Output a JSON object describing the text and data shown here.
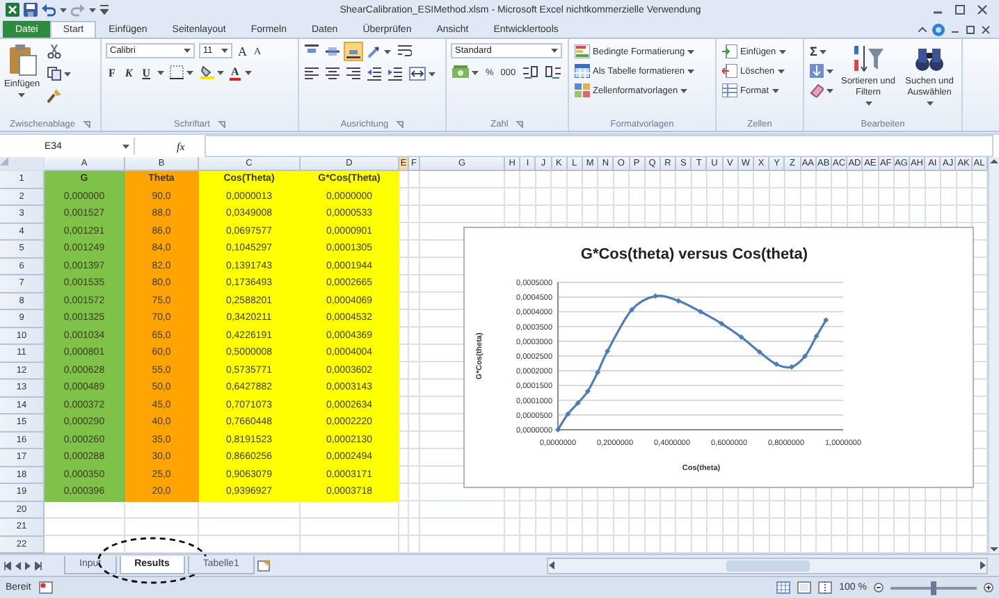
{
  "window": {
    "title": "ShearCalibration_ESIMethod.xlsm - Microsoft Excel nichtkommerzielle Verwendung"
  },
  "tabs": [
    {
      "label": "Datei",
      "kind": "file",
      "selected": false
    },
    {
      "label": "Start",
      "kind": "tab",
      "selected": true
    },
    {
      "label": "Einfügen",
      "kind": "tab",
      "selected": false
    },
    {
      "label": "Seitenlayout",
      "kind": "tab",
      "selected": false
    },
    {
      "label": "Formeln",
      "kind": "tab",
      "selected": false
    },
    {
      "label": "Daten",
      "kind": "tab",
      "selected": false
    },
    {
      "label": "Überprüfen",
      "kind": "tab",
      "selected": false
    },
    {
      "label": "Ansicht",
      "kind": "tab",
      "selected": false
    },
    {
      "label": "Entwicklertools",
      "kind": "tab",
      "selected": false
    }
  ],
  "ribbon": [
    {
      "kind": "clipboard",
      "label": "Zwischenablage",
      "paste": "Einfügen"
    },
    {
      "kind": "font",
      "label": "Schriftart",
      "font": "Calibri",
      "size": "11",
      "grow": "A",
      "shrink": "A",
      "styles": [
        "F",
        "K",
        "U"
      ],
      "color_letter": "A"
    },
    {
      "kind": "alignment",
      "label": "Ausrichtung",
      "vertical_align": [
        {
          "selected": false
        },
        {
          "selected": false
        },
        {
          "selected": true
        }
      ]
    },
    {
      "kind": "number",
      "label": "Zahl",
      "format": "Standard",
      "percent": "%",
      "thousands": "000"
    },
    {
      "kind": "styles",
      "label": "Formatvorlagen",
      "commands": [
        "Bedingte Formatierung",
        "Als Tabelle formatieren",
        "Zellenformatvorlagen"
      ]
    },
    {
      "kind": "cells",
      "label": "Zellen",
      "commands": [
        "Einfügen",
        "Löschen",
        "Format"
      ]
    },
    {
      "kind": "editing",
      "label": "Bearbeiten",
      "sum": "Σ",
      "commands": [
        "Sortieren und Filtern",
        "Suchen und Auswählen"
      ]
    }
  ],
  "formula_bar": {
    "name_box": "E34",
    "function_label": "fx"
  },
  "columns": [
    {
      "label": "A",
      "color": "#7fc24a",
      "selected": false
    },
    {
      "label": "B",
      "color": "#ffa400",
      "selected": false
    },
    {
      "label": "C",
      "color": "#ffff00",
      "selected": false
    },
    {
      "label": "D",
      "color": "#ffff00",
      "selected": false
    },
    {
      "label": "E",
      "selected": true
    },
    {
      "label": "F",
      "selected": false
    },
    {
      "label": "G",
      "selected": false
    },
    {
      "label": "H",
      "selected": false
    },
    {
      "label": "I",
      "selected": false
    },
    {
      "label": "J",
      "selected": false
    },
    {
      "label": "K",
      "selected": false
    },
    {
      "label": "L",
      "selected": false
    },
    {
      "label": "M",
      "selected": false
    },
    {
      "label": "N",
      "selected": false
    },
    {
      "label": "O",
      "selected": false
    },
    {
      "label": "P",
      "selected": false
    },
    {
      "label": "Q",
      "selected": false
    },
    {
      "label": "R",
      "selected": false
    },
    {
      "label": "S",
      "selected": false
    },
    {
      "label": "T",
      "selected": false
    },
    {
      "label": "U",
      "selected": false
    },
    {
      "label": "V",
      "selected": false
    },
    {
      "label": "W",
      "selected": false
    },
    {
      "label": "X",
      "selected": false
    },
    {
      "label": "Y",
      "selected": false
    },
    {
      "label": "Z",
      "selected": false
    },
    {
      "label": "AA",
      "selected": false
    },
    {
      "label": "AB",
      "selected": false
    },
    {
      "label": "AC",
      "selected": false
    },
    {
      "label": "AD",
      "selected": false
    },
    {
      "label": "AE",
      "selected": false
    },
    {
      "label": "AF",
      "selected": false
    },
    {
      "label": "AG",
      "selected": false
    },
    {
      "label": "AH",
      "selected": false
    },
    {
      "label": "AI",
      "selected": false
    },
    {
      "label": "AJ",
      "selected": false
    },
    {
      "label": "AK",
      "selected": false
    },
    {
      "label": "AL",
      "selected": false
    }
  ],
  "rows": [
    {
      "number": "1",
      "kind": "header",
      "cells": [
        "G",
        "Theta",
        "Cos(Theta)",
        "G*Cos(Theta)"
      ]
    },
    {
      "number": "2",
      "cells": [
        "0,000000",
        "90,0",
        "0,0000013",
        "0,0000000"
      ]
    },
    {
      "number": "3",
      "cells": [
        "0,001527",
        "88,0",
        "0,0349008",
        "0,0000533"
      ]
    },
    {
      "number": "4",
      "cells": [
        "0,001291",
        "86,0",
        "0,0697577",
        "0,0000901"
      ]
    },
    {
      "number": "5",
      "cells": [
        "0,001249",
        "84,0",
        "0,1045297",
        "0,0001305"
      ]
    },
    {
      "number": "6",
      "cells": [
        "0,001397",
        "82,0",
        "0,1391743",
        "0,0001944"
      ]
    },
    {
      "number": "7",
      "cells": [
        "0,001535",
        "80,0",
        "0,1736493",
        "0,0002665"
      ]
    },
    {
      "number": "8",
      "cells": [
        "0,001572",
        "75,0",
        "0,2588201",
        "0,0004069"
      ]
    },
    {
      "number": "9",
      "cells": [
        "0,001325",
        "70,0",
        "0,3420211",
        "0,0004532"
      ]
    },
    {
      "number": "10",
      "cells": [
        "0,001034",
        "65,0",
        "0,4226191",
        "0,0004369"
      ]
    },
    {
      "number": "11",
      "cells": [
        "0,000801",
        "60,0",
        "0,5000008",
        "0,0004004"
      ]
    },
    {
      "number": "12",
      "cells": [
        "0,000628",
        "55,0",
        "0,5735771",
        "0,0003602"
      ]
    },
    {
      "number": "13",
      "cells": [
        "0,000489",
        "50,0",
        "0,6427882",
        "0,0003143"
      ]
    },
    {
      "number": "14",
      "cells": [
        "0,000372",
        "45,0",
        "0,7071073",
        "0,0002634"
      ]
    },
    {
      "number": "15",
      "cells": [
        "0,000290",
        "40,0",
        "0,7660448",
        "0,0002220"
      ]
    },
    {
      "number": "16",
      "cells": [
        "0,000260",
        "35,0",
        "0,8191523",
        "0,0002130"
      ]
    },
    {
      "number": "17",
      "cells": [
        "0,000288",
        "30,0",
        "0,8660256",
        "0,0002494"
      ]
    },
    {
      "number": "18",
      "cells": [
        "0,000350",
        "25,0",
        "0,9063079",
        "0,0003171"
      ]
    },
    {
      "number": "19",
      "cells": [
        "0,000396",
        "20,0",
        "0,9396927",
        "0,0003718"
      ]
    },
    {
      "number": "20"
    },
    {
      "number": "21"
    },
    {
      "number": "22"
    }
  ],
  "chart": {
    "chart_data": {
      "type": "line",
      "title": "G*Cos(theta) versus Cos(theta)",
      "xlabel": "Cos(theta)",
      "ylabel": "G*Cos(theta)",
      "x": [
        1.3e-06,
        0.0349008,
        0.0697577,
        0.1045297,
        0.1391743,
        0.1736493,
        0.2588201,
        0.3420211,
        0.4226191,
        0.5000008,
        0.5735771,
        0.6427882,
        0.7071073,
        0.7660448,
        0.8191523,
        0.8660256,
        0.9063079,
        0.9396927
      ],
      "grid": true,
      "series": [
        {
          "color": "#4a7ebb",
          "marker": "diamond",
          "values": [
            0,
            5.33e-05,
            9.01e-05,
            0.0001305,
            0.0001944,
            0.0002665,
            0.0004069,
            0.0004532,
            0.0004369,
            0.0004004,
            0.0003602,
            0.0003143,
            0.0002634,
            0.000222,
            0.000213,
            0.0002494,
            0.0003171,
            0.0003718
          ]
        }
      ],
      "xlim": [
        0,
        1
      ],
      "ylim": [
        0,
        0.0005
      ],
      "xticks": [
        {
          "value": 0,
          "label": "0,0000000"
        },
        {
          "value": 0.2,
          "label": "0,2000000"
        },
        {
          "value": 0.4,
          "label": "0,4000000"
        },
        {
          "value": 0.6,
          "label": "0,6000000"
        },
        {
          "value": 0.8,
          "label": "0,8000000"
        },
        {
          "value": 1,
          "label": "1,0000000"
        }
      ],
      "yticks": [
        {
          "value": 0,
          "label": "0,0000000"
        },
        {
          "value": 5e-05,
          "label": "0,0000500"
        },
        {
          "value": 0.0001,
          "label": "0,0001000"
        },
        {
          "value": 0.00015,
          "label": "0,0001500"
        },
        {
          "value": 0.0002,
          "label": "0,0002000"
        },
        {
          "value": 0.00025,
          "label": "0,0002500"
        },
        {
          "value": 0.0003,
          "label": "0,0003000"
        },
        {
          "value": 0.00035,
          "label": "0,0003500"
        },
        {
          "value": 0.0004,
          "label": "0,0004000"
        },
        {
          "value": 0.00045,
          "label": "0,0004500"
        },
        {
          "value": 0.0005,
          "label": "0,0005000"
        }
      ]
    }
  },
  "sheet_tabs": [
    {
      "label": "Input",
      "selected": false,
      "circled": false
    },
    {
      "label": "Results",
      "selected": true,
      "circled": true
    },
    {
      "label": "Tabelle1",
      "selected": false,
      "circled": false
    }
  ],
  "status_bar": {
    "text": "Bereit",
    "zoom": {
      "label": "100 %",
      "level": 0.5
    }
  }
}
